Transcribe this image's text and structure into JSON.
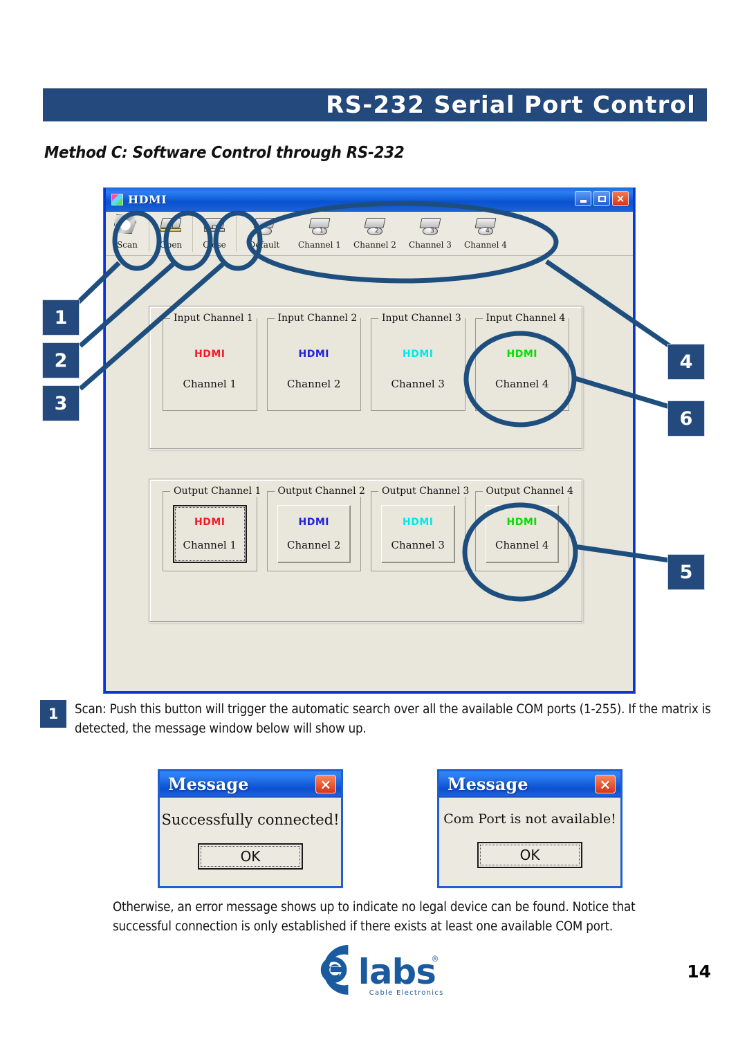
{
  "page": {
    "banner_title": "RS-232 Serial Port Control",
    "section_heading": "Method C: Software Control through RS-232",
    "page_number": "14"
  },
  "app_window": {
    "title": "HDMI",
    "icon": "hdmi-app-icon",
    "window_buttons": {
      "minimize": "minimize-button",
      "maximize": "maximize-button",
      "close": "×"
    },
    "toolbar": [
      {
        "label": "Scan",
        "icon": "scan-icon"
      },
      {
        "label": "Open",
        "icon": "open-port-icon"
      },
      {
        "label": "Close",
        "icon": "close-port-icon"
      },
      {
        "label": "Default",
        "icon": "default-preset-icon"
      },
      {
        "label": "Channel 1",
        "icon": "preset-channel-1-icon"
      },
      {
        "label": "Channel 2",
        "icon": "preset-channel-2-icon"
      },
      {
        "label": "Channel 3",
        "icon": "preset-channel-3-icon"
      },
      {
        "label": "Channel 4",
        "icon": "preset-channel-4-icon"
      }
    ],
    "input_section": {
      "channels": [
        {
          "title": "Input Channel 1",
          "logo": "HDMI",
          "value": "Channel 1",
          "color": "#ee1c25"
        },
        {
          "title": "Input Channel 2",
          "logo": "HDMI",
          "value": "Channel 2",
          "color": "#2020dd"
        },
        {
          "title": "Input Channel 3",
          "logo": "HDMI",
          "value": "Channel 3",
          "color": "#00e5f0"
        },
        {
          "title": "Input Channel 4",
          "logo": "HDMI",
          "value": "Channel 4",
          "color": "#00e000"
        }
      ]
    },
    "output_section": {
      "channels": [
        {
          "title": "Output Channel 1",
          "logo": "HDMI",
          "value": "Channel 1",
          "color": "#ee1c25",
          "selected": true
        },
        {
          "title": "Output Channel 2",
          "logo": "HDMI",
          "value": "Channel 2",
          "color": "#2020dd",
          "selected": false
        },
        {
          "title": "Output Channel 3",
          "logo": "HDMI",
          "value": "Channel 3",
          "color": "#00e5f0",
          "selected": false
        },
        {
          "title": "Output Channel 4",
          "logo": "HDMI",
          "value": "Channel 4",
          "color": "#00e000",
          "selected": false
        }
      ]
    }
  },
  "callouts": {
    "left": [
      "1",
      "2",
      "3"
    ],
    "right_top": [
      "4",
      "6"
    ],
    "right_bottom": [
      "5"
    ]
  },
  "body": {
    "step_number": "1",
    "step_text": "Scan: Push this button will trigger the automatic search over all the available COM ports (1-255). If the matrix is detected, the message window below will show up.",
    "closing_text": "Otherwise, an error message shows up to indicate no legal device can be found. Notice that successful connection is only established if there exists at least one available COM port."
  },
  "dialogs": [
    {
      "title": "Message",
      "message": "Successfully connected!",
      "ok_label": "OK",
      "close_label": "×"
    },
    {
      "title": "Message",
      "message": "Com Port is not available!",
      "ok_label": "OK",
      "close_label": "×"
    }
  ],
  "logo": {
    "brand": "labs",
    "tagline": "Cable Electronics",
    "registered": "®",
    "color": "#1a5a9e"
  },
  "colors": {
    "accent": "#244a7d",
    "window_frame": "#0a36d8",
    "dialog_frame": "#1f5fd0",
    "face": "#e9e6dc"
  }
}
